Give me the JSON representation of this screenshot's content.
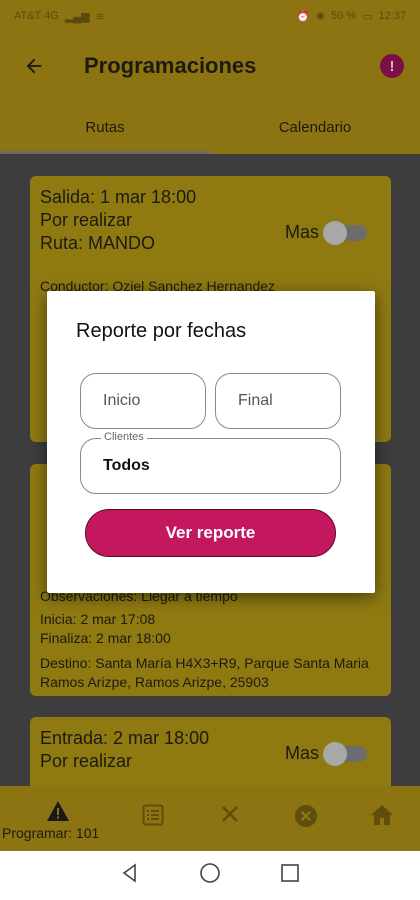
{
  "status_bar": {
    "carrier": "AT&T 4G",
    "battery": "50 %",
    "time": "12:37"
  },
  "app_bar": {
    "title": "Programaciones",
    "alert_symbol": "!"
  },
  "tabs": [
    {
      "label": "Rutas",
      "active": true
    },
    {
      "label": "Calendario",
      "active": false
    }
  ],
  "cards": [
    {
      "line1": "Salida: 1 mar 18:00",
      "line2": "Por realizar",
      "line3": "Ruta: MANDO",
      "toggle_label": "Mas",
      "conductor": "Conductor: Oziel Sanchez Hernandez"
    },
    {
      "observaciones": "Observaciones: Llegar a tiempo",
      "inicia": "Inicia: 2 mar 17:08",
      "finaliza": "Finaliza: 2 mar 18:00",
      "destino": "Destino: Santa María H4X3+R9, Parque Santa Maria Ramos Arizpe, Ramos Arizpe, 25903"
    },
    {
      "line1": "Entrada: 2 mar 18:00",
      "line2": "Por realizar",
      "toggle_label": "Mas"
    }
  ],
  "dialog": {
    "title": "Reporte por fechas",
    "inicio_placeholder": "Inicio",
    "final_placeholder": "Final",
    "clientes_label": "Clientes",
    "clientes_value": "Todos",
    "button_label": "Ver reporte"
  },
  "bottom_bar": {
    "programar_label": "Programar: 101"
  },
  "colors": {
    "accent": "#c3185d",
    "appbar": "#8d7413",
    "card": "#8f7a12"
  }
}
